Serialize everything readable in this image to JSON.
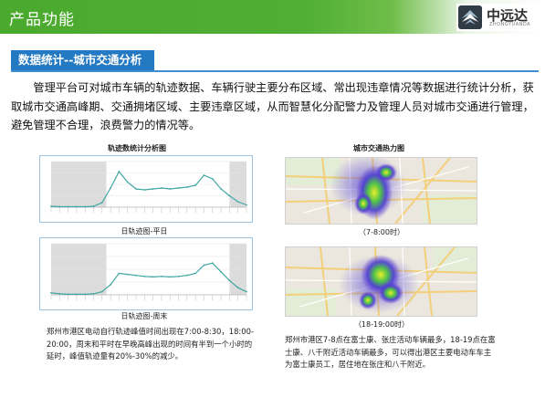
{
  "header": {
    "title": "产品功能",
    "logo_text": "中远达",
    "logo_sub": "ZHONGYUANDA",
    "colors": {
      "green": "#4aaa2e",
      "blue": "#2479c3"
    }
  },
  "section": {
    "label": "数据统计--城市交通分析"
  },
  "paragraph": "管理平台可对城市车辆的轨迹数据、车辆行驶主要分布区域、常出现违章情况等数据进行统计分析，获取城市交通高峰期、交通拥堵区域、主要违章区域，从而智慧化分配警力及管理人员对城市交通进行管理，避免管理不合理，浪费警力的情况等。",
  "left_column": {
    "title": "轨迹数统计分析图",
    "caption_weekday": "日轨迹图-平日",
    "caption_weekend": "日轨迹图-周末",
    "note": "郑州市港区电动自行轨迹峰值时间出现在7:00-8:30，18:00-20:00，周末和平时在早晚高峰出现的时间有半到一个小时的延时，峰值轨迹量有20%-30%的减少。"
  },
  "right_column": {
    "title": "城市交通热力图",
    "caption_morning": "（7-8:00时）",
    "caption_evening": "（18-19:00时）",
    "note": "郑州市港区7-8点在富士康、张庄活动车辆最多，18-19点在富士康、八千附近活动车辆最多，可以得出港区主要电动车车主为富士康员工，居住地在张庄和八千附近。"
  },
  "chart_data": [
    {
      "type": "line",
      "name_ref": "weekday",
      "x": [
        0,
        1,
        2,
        3,
        4,
        5,
        6,
        7,
        8,
        9,
        10,
        11,
        12,
        13,
        14,
        15,
        16,
        17,
        18,
        19,
        20,
        21,
        22,
        23
      ],
      "values": [
        2,
        1,
        1,
        1,
        1,
        2,
        10,
        42,
        78,
        55,
        40,
        38,
        40,
        42,
        40,
        42,
        44,
        48,
        70,
        62,
        40,
        25,
        12,
        5
      ],
      "ylim": [
        0,
        100
      ],
      "grid": true,
      "shaded_periods": [
        [
          0,
          6.5
        ],
        [
          21,
          23
        ]
      ]
    },
    {
      "type": "line",
      "name_ref": "weekend",
      "x": [
        0,
        1,
        2,
        3,
        4,
        5,
        6,
        7,
        8,
        9,
        10,
        11,
        12,
        13,
        14,
        15,
        16,
        17,
        18,
        19,
        20,
        21,
        22,
        23
      ],
      "values": [
        4,
        2,
        1,
        1,
        1,
        2,
        6,
        20,
        42,
        40,
        38,
        36,
        35,
        36,
        35,
        36,
        38,
        42,
        58,
        62,
        45,
        28,
        14,
        6
      ],
      "ylim": [
        0,
        100
      ],
      "grid": true,
      "shaded_periods": [
        [
          0,
          6.5
        ],
        [
          21,
          23
        ]
      ]
    }
  ]
}
